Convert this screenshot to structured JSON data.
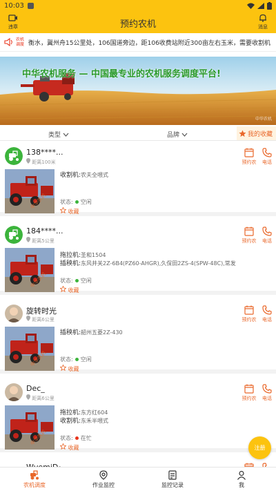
{
  "status_bar": {
    "time": "10:03"
  },
  "app_bar": {
    "title": "预约农机",
    "left_label": "违章",
    "right_label": "消息"
  },
  "notice": {
    "badge": "农机调度",
    "text": "衡水，冀州舟15公里处，106国道旁边，距106收费站附近300亩左右玉米，需要收割机"
  },
  "banner": {
    "headline": "中华农机服务 — 中国最专业的农机服务调度平台!"
  },
  "filters": {
    "type_label": "类型",
    "brand_label": "品牌",
    "favorites_label": "我的收藏"
  },
  "cards": [
    {
      "name": "138****...",
      "distance": "距离100米",
      "specs": [
        {
          "label": "收割机:",
          "value": "农夫全喂式"
        }
      ],
      "status_label": "状态:",
      "status_value": "空闲",
      "status_color": "#3cb43c",
      "collect_label": "收藏",
      "avatar": "tractor-logo"
    },
    {
      "name": "184****...",
      "distance": "距离5公里",
      "specs": [
        {
          "label": "拖拉机:",
          "value": "圣和1504"
        },
        {
          "label": "插秧机:",
          "value": "东风井关2Z-6B4(PZ60-AHGR),久保田2ZS-4(SPW-48C),常发2..."
        }
      ],
      "status_label": "状态:",
      "status_value": "空闲",
      "status_color": "#3cb43c",
      "collect_label": "收藏",
      "avatar": "tractor-logo"
    },
    {
      "name": "旋转时光",
      "distance": "距离6公里",
      "specs": [
        {
          "label": "插秧机:",
          "value": "韶州五菱2Z-430"
        }
      ],
      "status_label": "状态:",
      "status_value": "空闲",
      "status_color": "#3cb43c",
      "collect_label": "收藏",
      "avatar": "photo"
    },
    {
      "name": "Dec_",
      "distance": "距离6公里",
      "specs": [
        {
          "label": "拖拉机:",
          "value": "东方红604"
        },
        {
          "label": "收割机:",
          "value": "东禾半喂式"
        }
      ],
      "status_label": "状态:",
      "status_value": "在忙",
      "status_color": "#e8341c",
      "collect_label": "收藏",
      "avatar": "photo"
    },
    {
      "name": "WvemiD₀",
      "distance": "",
      "specs": [],
      "status_label": "",
      "status_value": "",
      "status_color": "#3cb43c",
      "collect_label": "",
      "avatar": "logo"
    }
  ],
  "card_actions": {
    "appointment": "预约农",
    "call": "电话"
  },
  "fab_label": "注册",
  "tabbar": [
    {
      "label": "农机调度",
      "icon": "tractor-icon",
      "active": true
    },
    {
      "label": "作业监控",
      "icon": "location-icon",
      "active": false
    },
    {
      "label": "监控记录",
      "icon": "record-icon",
      "active": false
    },
    {
      "label": "我",
      "icon": "user-icon",
      "active": false
    }
  ],
  "colors": {
    "brand": "#fcc30f",
    "accent": "#e9682b",
    "free": "#3cb43c",
    "busy": "#e8341c"
  }
}
